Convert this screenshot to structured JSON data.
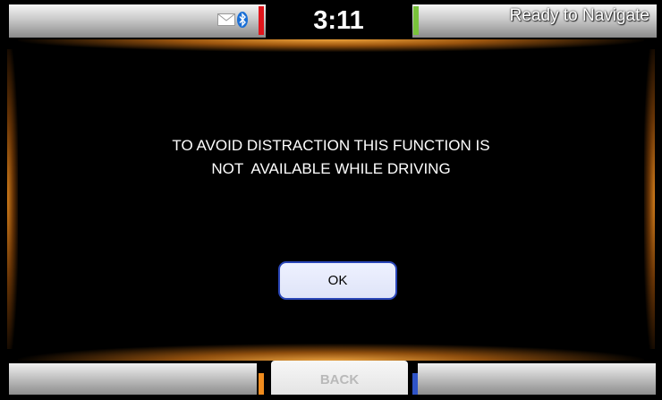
{
  "status_bar": {
    "time": "3:11",
    "nav_status": "Ready to Navigate",
    "icons": [
      "message-icon",
      "bluetooth-icon"
    ]
  },
  "dialog": {
    "message_lines": [
      "TO AVOID DISTRACTION THIS FUNCTION IS",
      "NOT  AVAILABLE WHILE DRIVING"
    ],
    "ok_label": "OK"
  },
  "bottom_bar": {
    "back_label": "BACK"
  },
  "colors": {
    "background": "#000000",
    "accent_glow": "#f08c1e",
    "ok_border": "#2a46b8",
    "red_marker": "#e0151b",
    "green_marker": "#79c23b",
    "orange_marker": "#f08c1e",
    "blue_marker": "#2f54c7"
  }
}
